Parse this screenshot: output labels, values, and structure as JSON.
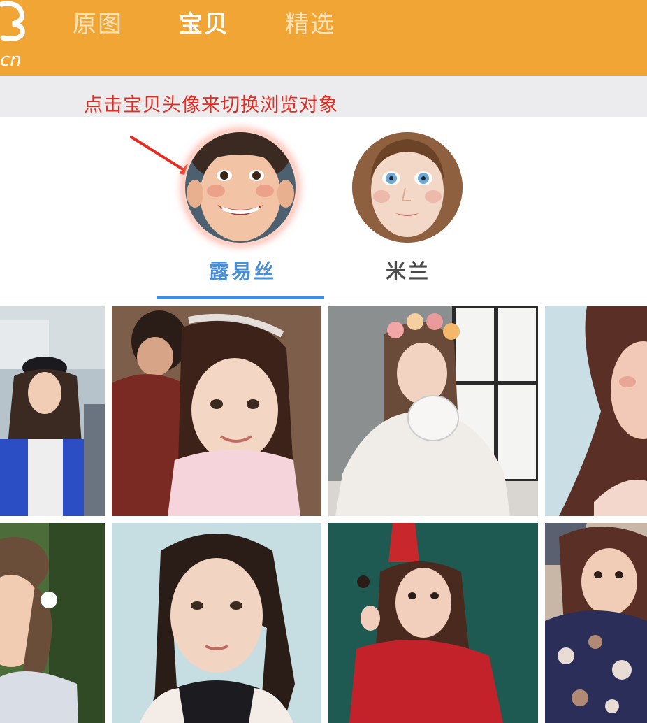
{
  "header": {
    "logo_icon": "cartoon-logo-icon",
    "logo_text": "cn",
    "tabs": [
      {
        "label": "原图",
        "active": false
      },
      {
        "label": "宝贝",
        "active": true
      },
      {
        "label": "精选",
        "active": false
      }
    ]
  },
  "hint": {
    "text": "点击宝贝头像来切换浏览对象",
    "arrow_icon": "red-arrow-icon"
  },
  "babies": [
    {
      "name": "露易丝",
      "selected": true
    },
    {
      "name": "米兰",
      "selected": false
    }
  ],
  "colors": {
    "header_bg": "#f0a535",
    "active_tab_text": "#ffffff",
    "inactive_tab_text": "#fbe3bb",
    "hint_bg": "#ececee",
    "hint_text": "#e32d22",
    "selected_name": "#4a8fd6",
    "unselected_name": "#4a4a4a",
    "tab_indicator": "#3b8fe0"
  }
}
